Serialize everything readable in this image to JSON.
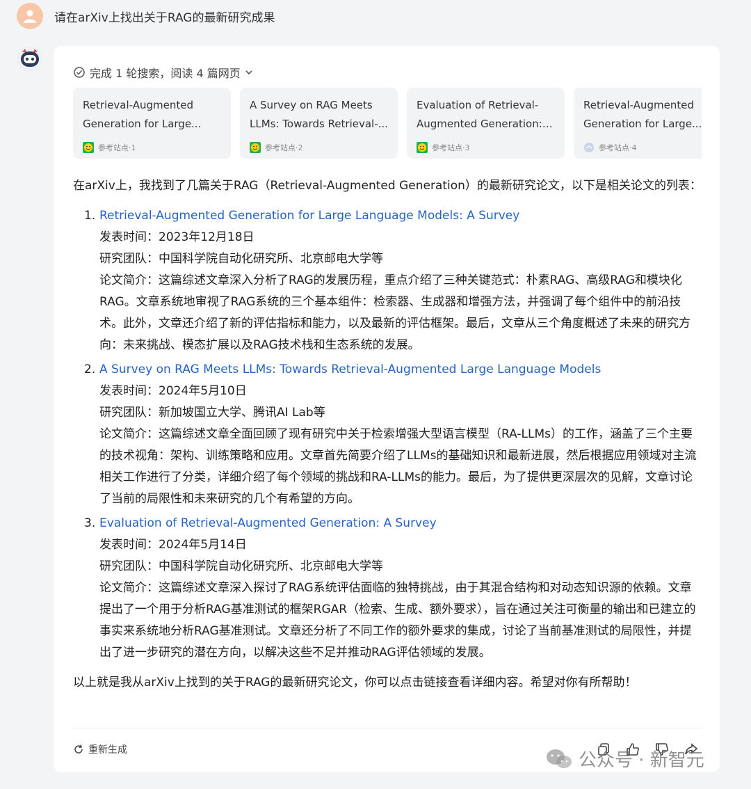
{
  "user": {
    "message": "请在arXiv上找出关于RAG的最新研究成果"
  },
  "search": {
    "summary": "完成 1 轮搜索，阅读 4 篇网页"
  },
  "sources": [
    {
      "line1": "Retrieval-Augmented",
      "line2": "Generation for Large...",
      "site": "参考站点·1"
    },
    {
      "line1": "A Survey on RAG Meets",
      "line2": "LLMs: Towards Retrieval-...",
      "site": "参考站点·2"
    },
    {
      "line1": "Evaluation of Retrieval-",
      "line2": "Augmented Generation: ...",
      "site": "参考站点·3"
    },
    {
      "line1": "Retrieval-Augmented",
      "line2": "Generation for Large...",
      "site": "参考站点·4"
    }
  ],
  "answer": {
    "intro": "在arXiv上，我找到了几篇关于RAG（Retrieval-Augmented Generation）的最新研究论文，以下是相关论文的列表：",
    "papers": [
      {
        "num": "1.",
        "title": "Retrieval-Augmented Generation for Large Language Models: A Survey",
        "date": "发表时间：2023年12月18日",
        "team": "研究团队：中国科学院自动化研究所、北京邮电大学等",
        "summary": "论文简介：这篇综述文章深入分析了RAG的发展历程，重点介绍了三种关键范式：朴素RAG、高级RAG和模块化RAG。文章系统地审视了RAG系统的三个基本组件：检索器、生成器和增强方法，并强调了每个组件中的前沿技术。此外，文章还介绍了新的评估指标和能力，以及最新的评估框架。最后，文章从三个角度概述了未来的研究方向：未来挑战、模态扩展以及RAG技术栈和生态系统的发展。"
      },
      {
        "num": "2.",
        "title": "A Survey on RAG Meets LLMs: Towards Retrieval-Augmented Large Language Models",
        "date": "发表时间：2024年5月10日",
        "team": "研究团队：新加坡国立大学、腾讯AI Lab等",
        "summary": "论文简介：这篇综述文章全面回顾了现有研究中关于检索增强大型语言模型（RA-LLMs）的工作，涵盖了三个主要的技术视角：架构、训练策略和应用。文章首先简要介绍了LLMs的基础知识和最新进展，然后根据应用领域对主流相关工作进行了分类，详细介绍了每个领域的挑战和RA-LLMs的能力。最后，为了提供更深层次的见解，文章讨论了当前的局限性和未来研究的几个有希望的方向。"
      },
      {
        "num": "3.",
        "title": "Evaluation of Retrieval-Augmented Generation: A Survey",
        "date": "发表时间：2024年5月14日",
        "team": "研究团队：中国科学院自动化研究所、北京邮电大学等",
        "summary": "论文简介：这篇综述文章深入探讨了RAG系统评估面临的独特挑战，由于其混合结构和对动态知识源的依赖。文章提出了一个用于分析RAG基准测试的框架RGAR（检索、生成、额外要求），旨在通过关注可衡量的输出和已建立的事实来系统地分析RAG基准测试。文章还分析了不同工作的额外要求的集成，讨论了当前基准测试的局限性，并提出了进一步研究的潜在方向，以解决这些不足并推动RAG评估领域的发展。"
      }
    ],
    "closing": "以上就是我从arXiv上找到的关于RAG的最新研究论文，你可以点击链接查看详细内容。希望对你有所帮助！"
  },
  "footer": {
    "regenerate": "重新生成"
  },
  "watermark": {
    "text": "公众号 · 新智元"
  },
  "colors": {
    "link": "#2563c9",
    "card_bg": "#ffffff",
    "page_bg": "#f3f4f6"
  }
}
